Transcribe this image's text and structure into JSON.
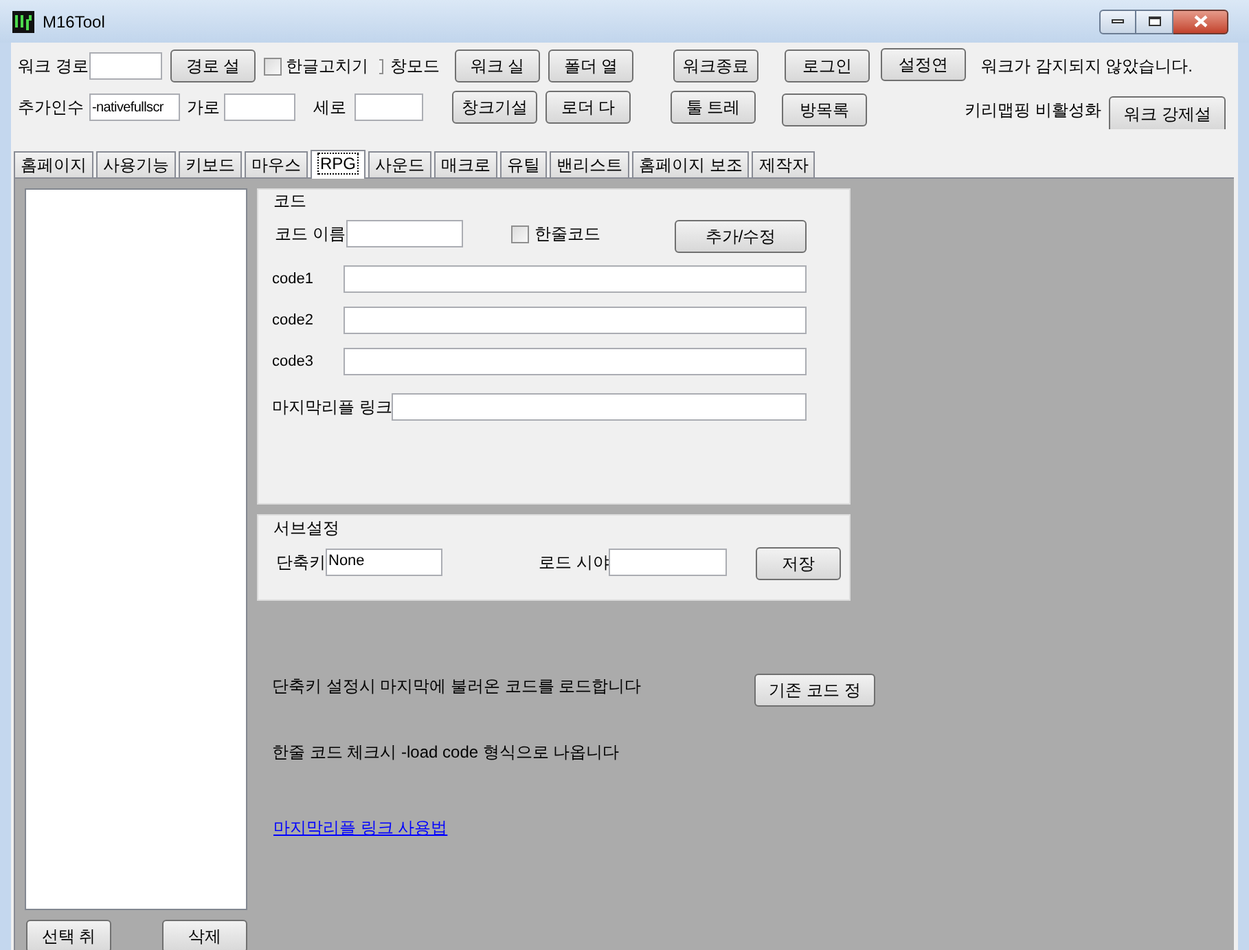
{
  "window": {
    "title": "M16Tool"
  },
  "top": {
    "path_label": "워크 경로",
    "path_button": "경로 설",
    "hangul_fix": {
      "label": "한글고치기",
      "checked": false
    },
    "window_mode": {
      "label": "창모드",
      "checked": false
    },
    "buttons_row1": [
      "워크 실",
      "폴더 열",
      "워크종료",
      "로그인",
      "설정연"
    ],
    "status": "워크가 감지되지 않았습니다.",
    "args_label": "추가인수",
    "args_value": "-nativefullscr",
    "width_label": "가로",
    "height_label": "세로",
    "buttons_row2": [
      "창크기설",
      "로더 다",
      "툴 트레",
      "방목록"
    ],
    "keymap_status": "키리맵핑 비활성화",
    "force_button": "워크 강제설"
  },
  "tabs": [
    {
      "label": "홈페이지",
      "selected": false
    },
    {
      "label": "사용기능",
      "selected": false
    },
    {
      "label": "키보드",
      "selected": false
    },
    {
      "label": "마우스",
      "selected": false
    },
    {
      "label": "RPG",
      "selected": true
    },
    {
      "label": "사운드",
      "selected": false
    },
    {
      "label": "매크로",
      "selected": false
    },
    {
      "label": "유틸",
      "selected": false
    },
    {
      "label": "밴리스트",
      "selected": false
    },
    {
      "label": "홈페이지 보조",
      "selected": false
    },
    {
      "label": "제작자",
      "selected": false
    }
  ],
  "left_panel": {
    "buttons": [
      "선택 취",
      "삭제"
    ]
  },
  "code_group": {
    "title": "코드",
    "name_label": "코드 이름",
    "one_line": {
      "label": "한줄코드",
      "checked": false
    },
    "add_button": "추가/수정",
    "code_fields": [
      "code1",
      "code2",
      "code3"
    ],
    "link_label": "마지막리플 링크"
  },
  "sub_group": {
    "title": "서브설정",
    "hotkey_label": "단축키",
    "hotkey_value": "None",
    "load_label": "로드 시야",
    "save_button": "저장"
  },
  "hotkey_note": "단축키 설정시 마지막에 불러온 코드를 로드합니다",
  "restore_button": "기존 코드 정",
  "one_line_note": "한줄 코드 체크시 -load code 형식으로 나옵니다",
  "help_link": "마지막리플 링크 사용법"
}
